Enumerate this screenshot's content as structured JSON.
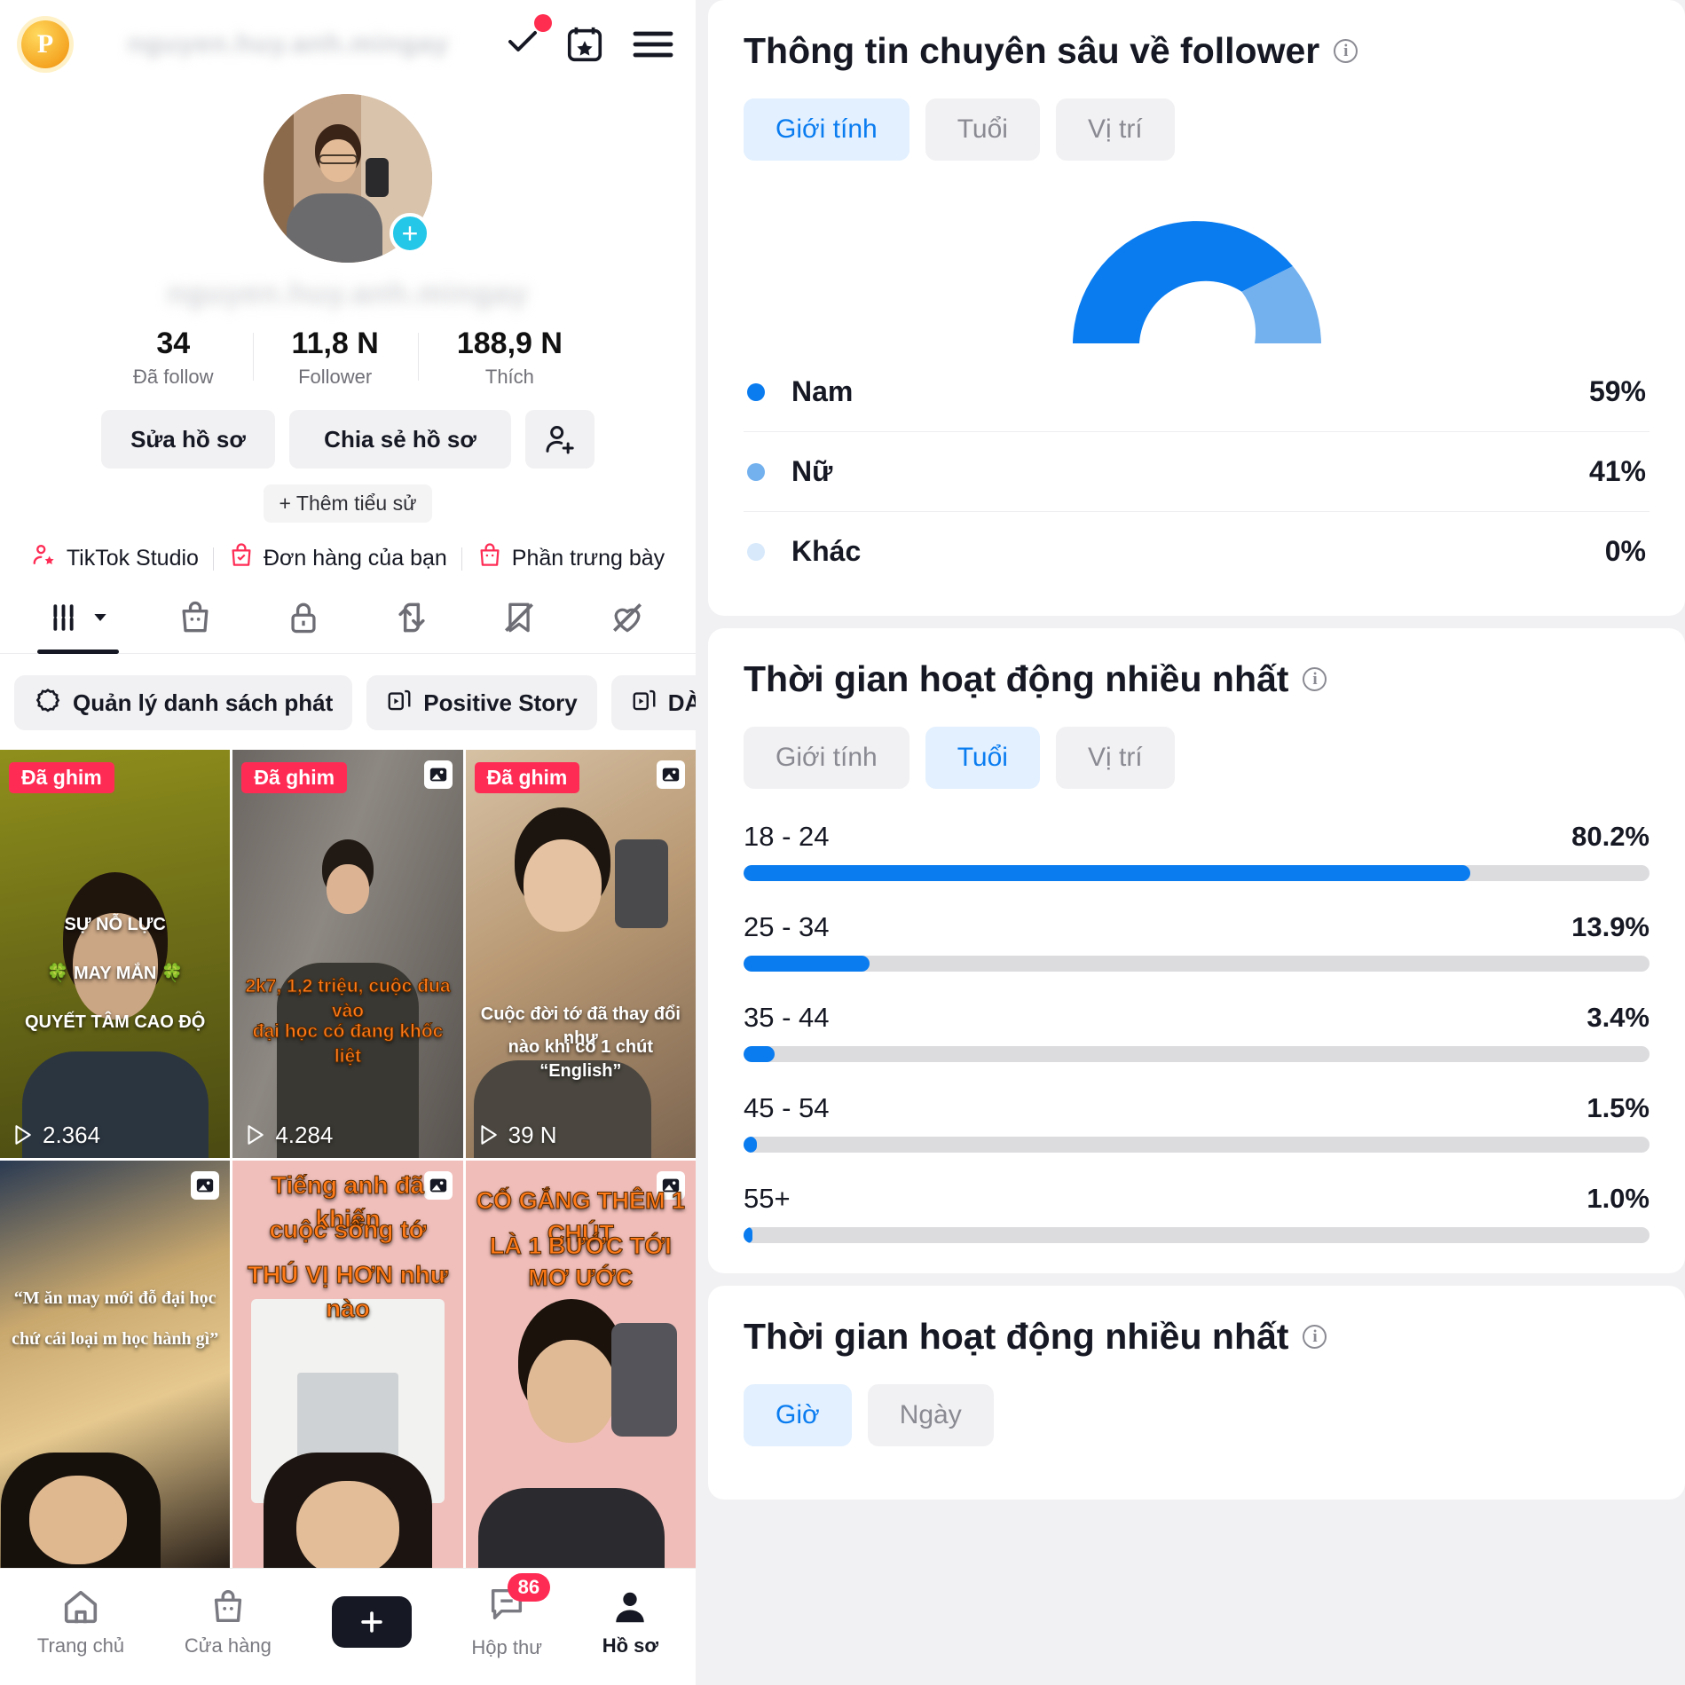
{
  "profile": {
    "coin_label": "P",
    "blurred_handle": "nguyen.huy.anh.mingay",
    "stats": [
      {
        "value": "34",
        "label": "Đã follow"
      },
      {
        "value": "11,8 N",
        "label": "Follower"
      },
      {
        "value": "188,9 N",
        "label": "Thích"
      }
    ],
    "edit_label": "Sửa hồ sơ",
    "share_label": "Chia sẻ hồ sơ",
    "bio_label": "+ Thêm tiểu sử",
    "links": [
      {
        "label": "TikTok Studio",
        "icon": "person-star-icon"
      },
      {
        "label": "Đơn hàng của bạn",
        "icon": "bag-check-icon"
      },
      {
        "label": "Phần trưng bày",
        "icon": "shop-bag-icon"
      }
    ],
    "tabs": [
      {
        "icon": "grid-posts-icon",
        "active": true
      },
      {
        "icon": "shopping-bag-icon",
        "active": false
      },
      {
        "icon": "lock-icon",
        "active": false
      },
      {
        "icon": "repost-icon",
        "active": false
      },
      {
        "icon": "bookmark-off-icon",
        "active": false
      },
      {
        "icon": "heart-off-icon",
        "active": false
      }
    ],
    "chips": [
      {
        "label": "Quản lý danh sách phát",
        "icon": "gear-icon"
      },
      {
        "label": "Positive Story",
        "icon": "playlist-icon"
      },
      {
        "label": "DÀNH",
        "icon": "playlist-icon"
      }
    ],
    "videos": [
      {
        "pinned": "Đã ghim",
        "multi": false,
        "views": "2.364",
        "caption": "SỰ NỖ LỰC",
        "caption2": "🍀 MAY MẮN 🍀",
        "caption3": "QUYẾT TÂM CAO ĐỘ",
        "style": "olive"
      },
      {
        "pinned": "Đã ghim",
        "multi": true,
        "views": "4.284",
        "caption": "2k7, 1,2 triệu, cuộc đua vào",
        "caption2": "đại học có đang khốc liệt",
        "caption3": "",
        "style": "grey"
      },
      {
        "pinned": "Đã ghim",
        "multi": true,
        "views": "39 N",
        "caption": "Cuộc đời tớ đã thay đổi như",
        "caption2": "nào khi có 1 chút “English”",
        "caption3": "",
        "style": "warm"
      },
      {
        "pinned": "",
        "multi": true,
        "views": "",
        "caption": "“M ăn may mới đỗ đại học",
        "caption2": "chứ cái loại m học hành gì”",
        "caption3": "",
        "style": "wood"
      },
      {
        "pinned": "",
        "multi": true,
        "views": "",
        "caption": "Tiếng anh đã khiến",
        "caption2": "cuộc sống tớ",
        "caption3": "THÚ VỊ HƠN như nào",
        "style": "pink"
      },
      {
        "pinned": "",
        "multi": true,
        "views": "",
        "caption": "CỐ GẮNG THÊM 1 CHÚT",
        "caption2": "LÀ 1 BƯỚC TỚI MƠ ƯỚC",
        "caption3": "",
        "style": "pink2"
      }
    ],
    "bottom_nav": [
      {
        "label": "Trang chủ",
        "icon": "home-icon",
        "active": false
      },
      {
        "label": "Cửa hàng",
        "icon": "shop-icon",
        "active": false
      },
      {
        "label": "",
        "icon": "create-plus-icon",
        "active": false
      },
      {
        "label": "Hộp thư",
        "icon": "inbox-icon",
        "active": false,
        "badge": "86"
      },
      {
        "label": "Hồ sơ",
        "icon": "profile-icon",
        "active": true
      }
    ]
  },
  "analytics": {
    "follower_card": {
      "title": "Thông tin chuyên sâu về follower",
      "segments": [
        {
          "label": "Giới tính",
          "active": true
        },
        {
          "label": "Tuổi",
          "active": false
        },
        {
          "label": "Vị trí",
          "active": false
        }
      ]
    },
    "activity_card": {
      "title": "Thời gian hoạt động nhiều nhất",
      "segments": [
        {
          "label": "Giới tính",
          "active": false
        },
        {
          "label": "Tuổi",
          "active": true
        },
        {
          "label": "Vị trí",
          "active": false
        }
      ]
    },
    "activity_card2": {
      "title": "Thời gian hoạt động nhiều nhất",
      "segments": [
        {
          "label": "Giờ",
          "active": true
        },
        {
          "label": "Ngày",
          "active": false
        }
      ]
    },
    "colors": {
      "primary": "#0a7cf0",
      "secondary": "#72b0ee",
      "tertiary": "#d7e9fb",
      "track": "#dcdcdf"
    }
  },
  "chart_data": [
    {
      "type": "pie",
      "title": "Thông tin chuyên sâu về follower",
      "subtitle": "Giới tính",
      "labels": [
        "Nam",
        "Nữ",
        "Khác"
      ],
      "values": [
        59,
        41,
        0
      ],
      "value_labels": [
        "59%",
        "41%",
        "0%"
      ],
      "colors": [
        "#0a7cf0",
        "#72b0ee",
        "#d7e9fb"
      ],
      "legend": "bottom",
      "note": "semi-circular donut gauge"
    },
    {
      "type": "bar",
      "title": "Thời gian hoạt động nhiều nhất",
      "subtitle": "Tuổi",
      "orientation": "horizontal",
      "categories": [
        "18 - 24",
        "25 - 34",
        "35 - 44",
        "45 - 54",
        "55+"
      ],
      "values": [
        80.2,
        13.9,
        3.4,
        1.5,
        1.0
      ],
      "value_labels": [
        "80.2%",
        "13.9%",
        "3.4%",
        "1.5%",
        "1.0%"
      ],
      "xlabel": "",
      "ylabel": "",
      "xlim": [
        0,
        100
      ],
      "grid": false,
      "color": "#0a7cf0"
    }
  ]
}
